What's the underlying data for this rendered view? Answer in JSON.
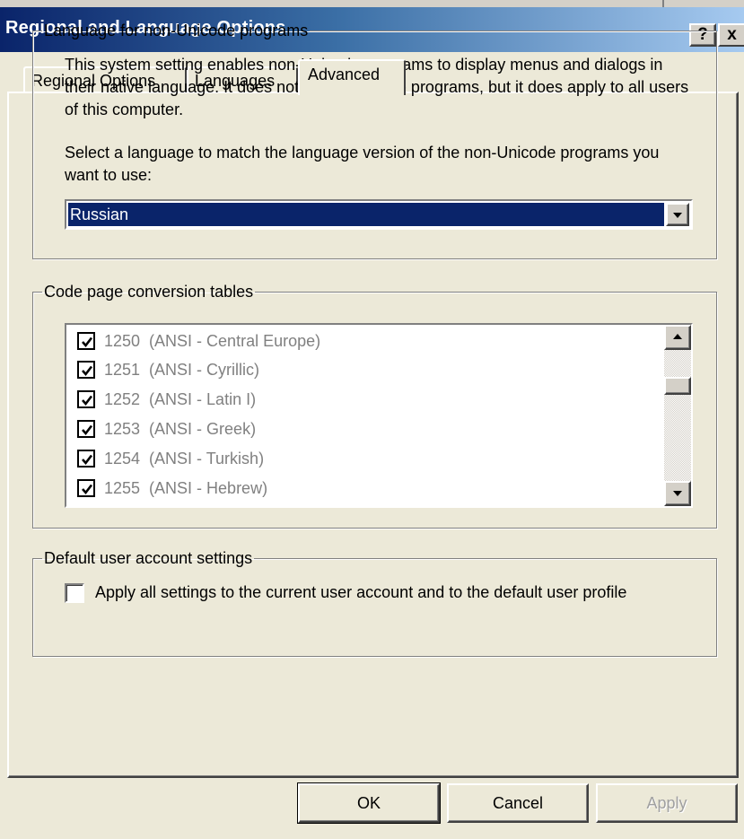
{
  "window": {
    "title": "Regional and Language Options",
    "help_label": "?",
    "close_label": "x"
  },
  "tabs": [
    {
      "label": "Regional Options"
    },
    {
      "label": "Languages"
    },
    {
      "label": "Advanced"
    }
  ],
  "non_unicode": {
    "group_label": "Language for non-Unicode programs",
    "description": "This system setting enables non-Unicode programs to display menus and dialogs in their native language. It does not affect Unicode programs, but it does apply to all users of this computer.",
    "prompt": "Select a language to match the language version of the non-Unicode programs you want to use:",
    "selected_language": "Russian"
  },
  "code_pages": {
    "group_label": "Code page conversion tables",
    "items": [
      {
        "label": "1250  (ANSI - Central Europe)",
        "checked": true
      },
      {
        "label": "1251  (ANSI - Cyrillic)",
        "checked": true
      },
      {
        "label": "1252  (ANSI - Latin I)",
        "checked": true
      },
      {
        "label": "1253  (ANSI - Greek)",
        "checked": true
      },
      {
        "label": "1254  (ANSI - Turkish)",
        "checked": true
      },
      {
        "label": "1255  (ANSI - Hebrew)",
        "checked": true
      }
    ]
  },
  "default_user": {
    "group_label": "Default user account settings",
    "apply_label": "Apply all settings to the current user account and to the default user profile",
    "checked": false
  },
  "buttons": {
    "ok": "OK",
    "cancel": "Cancel",
    "apply": "Apply"
  },
  "colors": {
    "title_start": "#0a246a",
    "title_end": "#a6caf0",
    "selection": "#0a246a",
    "face": "#ece9d8"
  }
}
